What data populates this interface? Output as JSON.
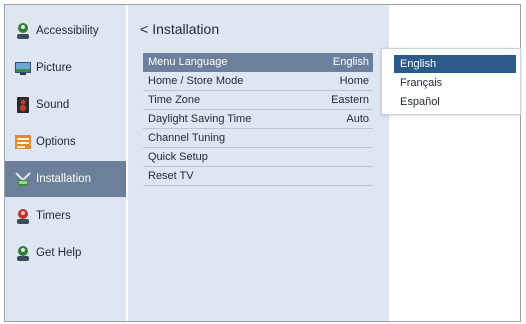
{
  "sidebar": {
    "items": [
      {
        "label": "Accessibility",
        "icon": "accessibility-icon"
      },
      {
        "label": "Picture",
        "icon": "picture-icon"
      },
      {
        "label": "Sound",
        "icon": "sound-icon"
      },
      {
        "label": "Options",
        "icon": "options-icon"
      },
      {
        "label": "Installation",
        "icon": "installation-icon",
        "active": true
      },
      {
        "label": "Timers",
        "icon": "timers-icon"
      },
      {
        "label": "Get Help",
        "icon": "get-help-icon"
      }
    ]
  },
  "main": {
    "back_chevron": "<",
    "title": "Installation",
    "rows": [
      {
        "name": "Menu Language",
        "value": "English",
        "selected": true
      },
      {
        "name": "Home / Store Mode",
        "value": "Home"
      },
      {
        "name": "Time Zone",
        "value": "Eastern"
      },
      {
        "name": "Daylight Saving Time",
        "value": "Auto"
      },
      {
        "name": "Channel Tuning",
        "value": ""
      },
      {
        "name": "Quick Setup",
        "value": ""
      },
      {
        "name": "Reset TV",
        "value": ""
      }
    ]
  },
  "language_dropdown": {
    "options": [
      "English",
      "Français",
      "Español"
    ],
    "selected": "English"
  },
  "colors": {
    "panel_bg": "#dde6f1",
    "highlight": "#6c7f9b",
    "dropdown_selected": "#2c5b8a"
  }
}
